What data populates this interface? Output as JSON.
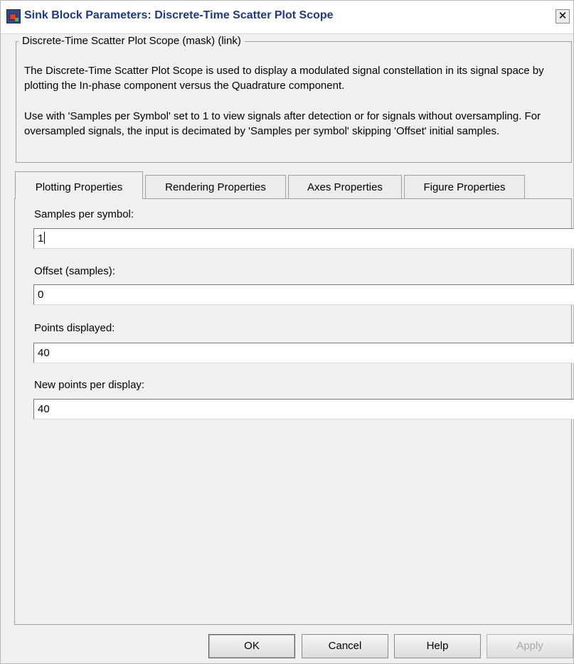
{
  "window": {
    "title": "Sink Block Parameters: Discrete-Time Scatter Plot Scope",
    "close_glyph": "✕",
    "app_icon": "simulink-block-icon"
  },
  "group": {
    "title": "Discrete-Time Scatter Plot Scope (mask) (link)",
    "description_1": "The Discrete-Time Scatter Plot Scope is used to display a modulated signal constellation in its signal space by plotting the In-phase component versus the Quadrature component.",
    "description_2": "Use with 'Samples per Symbol' set to 1 to view signals after detection or for signals without oversampling.  For oversampled signals, the input is decimated by 'Samples per symbol' skipping 'Offset' initial samples."
  },
  "tabs": [
    {
      "label": "Plotting Properties",
      "active": true
    },
    {
      "label": "Rendering Properties",
      "active": false
    },
    {
      "label": "Axes Properties",
      "active": false
    },
    {
      "label": "Figure Properties",
      "active": false
    }
  ],
  "fields": [
    {
      "label": "Samples per symbol:",
      "value": "1",
      "focused": true
    },
    {
      "label": "Offset (samples):",
      "value": "0"
    },
    {
      "label": "Points displayed:",
      "value": "40"
    },
    {
      "label": "New points per display:",
      "value": "40"
    }
  ],
  "buttons": {
    "ok": "OK",
    "cancel": "Cancel",
    "help": "Help",
    "apply": "Apply"
  },
  "colors": {
    "dialog_bg": "#f0f0f0",
    "title_text": "#1a3a8a",
    "disabled_text": "#a8a8a8"
  }
}
